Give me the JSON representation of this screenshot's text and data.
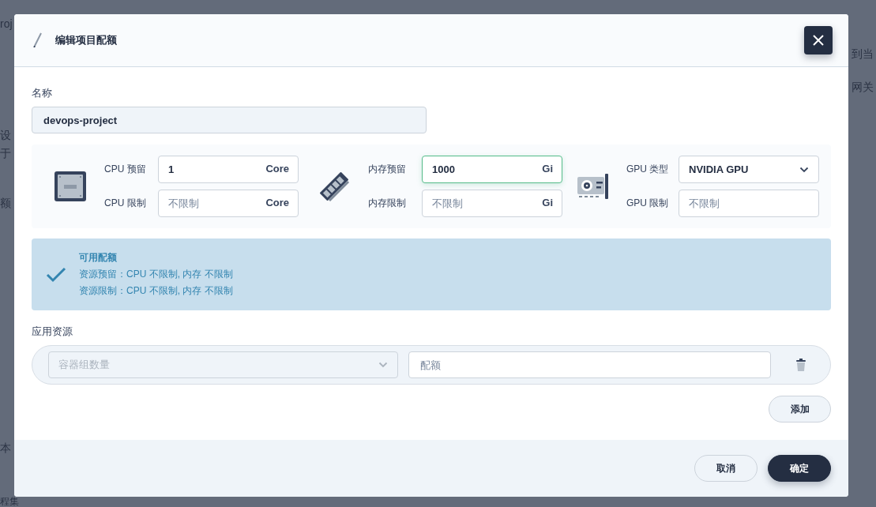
{
  "background": {
    "left_fragments": [
      "roj",
      "设",
      "于",
      "额",
      "本",
      "程集"
    ],
    "right_fragments": [
      "到当",
      "网关"
    ]
  },
  "dialog": {
    "title": "编辑项目配额",
    "name": {
      "label": "名称",
      "value": "devops-project"
    },
    "resources": [
      {
        "kind": "cpu",
        "fields": [
          {
            "kind": "input",
            "label": "CPU 预留",
            "value": "1",
            "unit": "Core",
            "focused": false
          },
          {
            "kind": "input",
            "label": "CPU 限制",
            "placeholder": "不限制",
            "unit": "Core",
            "focused": false
          }
        ]
      },
      {
        "kind": "memory",
        "fields": [
          {
            "kind": "input",
            "label": "内存预留",
            "value": "1000",
            "unit": "Gi",
            "focused": true
          },
          {
            "kind": "input",
            "label": "内存限制",
            "placeholder": "不限制",
            "unit": "Gi",
            "focused": false
          }
        ]
      },
      {
        "kind": "gpu",
        "fields": [
          {
            "kind": "select",
            "label": "GPU 类型",
            "value": "NVIDIA GPU",
            "focused": false
          },
          {
            "kind": "input",
            "label": "GPU 限制",
            "placeholder": "不限制",
            "focused": false
          }
        ]
      }
    ],
    "quota": {
      "title": "可用配额",
      "lines": [
        "资源预留：CPU 不限制, 内存 不限制",
        "资源限制：CPU 不限制, 内存 不限制"
      ]
    },
    "app_resources": {
      "label": "应用资源",
      "rows": [
        {
          "select_placeholder": "容器组数量",
          "input_placeholder": "配额"
        }
      ],
      "add_button": "添加"
    },
    "buttons": [
      {
        "label": "取消",
        "kind": "secondary"
      },
      {
        "label": "确定",
        "kind": "primary"
      }
    ]
  }
}
